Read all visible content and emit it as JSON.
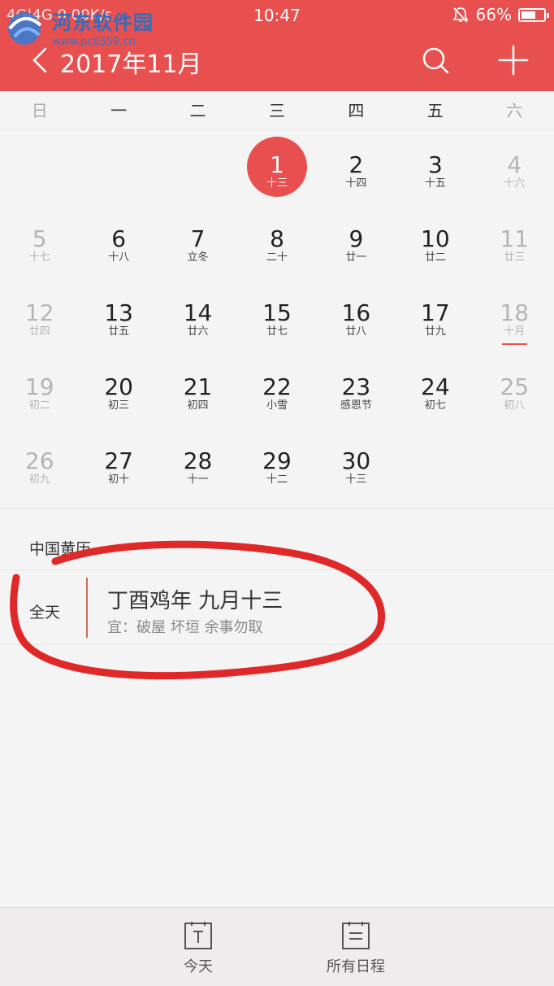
{
  "status_bar": {
    "network": "4G|4G 0.00K/s",
    "time": "10:47",
    "battery_text": "66%",
    "battery_level": 0.66
  },
  "watermark": {
    "title": "河东软件园",
    "url": "www.pc0359.cn"
  },
  "header": {
    "title": "2017年11月"
  },
  "weekdays": [
    "日",
    "一",
    "二",
    "三",
    "四",
    "五",
    "六"
  ],
  "calendar": {
    "today": "1",
    "weeks": [
      [
        null,
        null,
        null,
        {
          "d": "1",
          "l": "十三"
        },
        {
          "d": "2",
          "l": "十四"
        },
        {
          "d": "3",
          "l": "十五"
        },
        {
          "d": "4",
          "l": "十六"
        }
      ],
      [
        {
          "d": "5",
          "l": "十七"
        },
        {
          "d": "6",
          "l": "十八"
        },
        {
          "d": "7",
          "l": "立冬"
        },
        {
          "d": "8",
          "l": "二十"
        },
        {
          "d": "9",
          "l": "廿一"
        },
        {
          "d": "10",
          "l": "廿二"
        },
        {
          "d": "11",
          "l": "廿三"
        }
      ],
      [
        {
          "d": "12",
          "l": "廿四"
        },
        {
          "d": "13",
          "l": "廿五"
        },
        {
          "d": "14",
          "l": "廿六"
        },
        {
          "d": "15",
          "l": "廿七"
        },
        {
          "d": "16",
          "l": "廿八"
        },
        {
          "d": "17",
          "l": "廿九"
        },
        {
          "d": "18",
          "l": "十月"
        }
      ],
      [
        {
          "d": "19",
          "l": "初二"
        },
        {
          "d": "20",
          "l": "初三"
        },
        {
          "d": "21",
          "l": "初四"
        },
        {
          "d": "22",
          "l": "小雪"
        },
        {
          "d": "23",
          "l": "感恩节"
        },
        {
          "d": "24",
          "l": "初七"
        },
        {
          "d": "25",
          "l": "初八"
        }
      ],
      [
        {
          "d": "26",
          "l": "初九"
        },
        {
          "d": "27",
          "l": "初十"
        },
        {
          "d": "28",
          "l": "十一"
        },
        {
          "d": "29",
          "l": "十二"
        },
        {
          "d": "30",
          "l": "十三"
        },
        null,
        null
      ]
    ]
  },
  "almanac": {
    "section_title": "中国黄历",
    "allday_label": "全天",
    "event_title": "丁酉鸡年 九月十三",
    "event_detail": "宜：破屋 坏垣 余事勿取"
  },
  "bottom_nav": [
    {
      "label": "今天",
      "icon": "today-icon"
    },
    {
      "label": "所有日程",
      "icon": "all-events-icon"
    }
  ],
  "colors": {
    "accent": "#e84f4f",
    "annotation": "#e02828"
  }
}
